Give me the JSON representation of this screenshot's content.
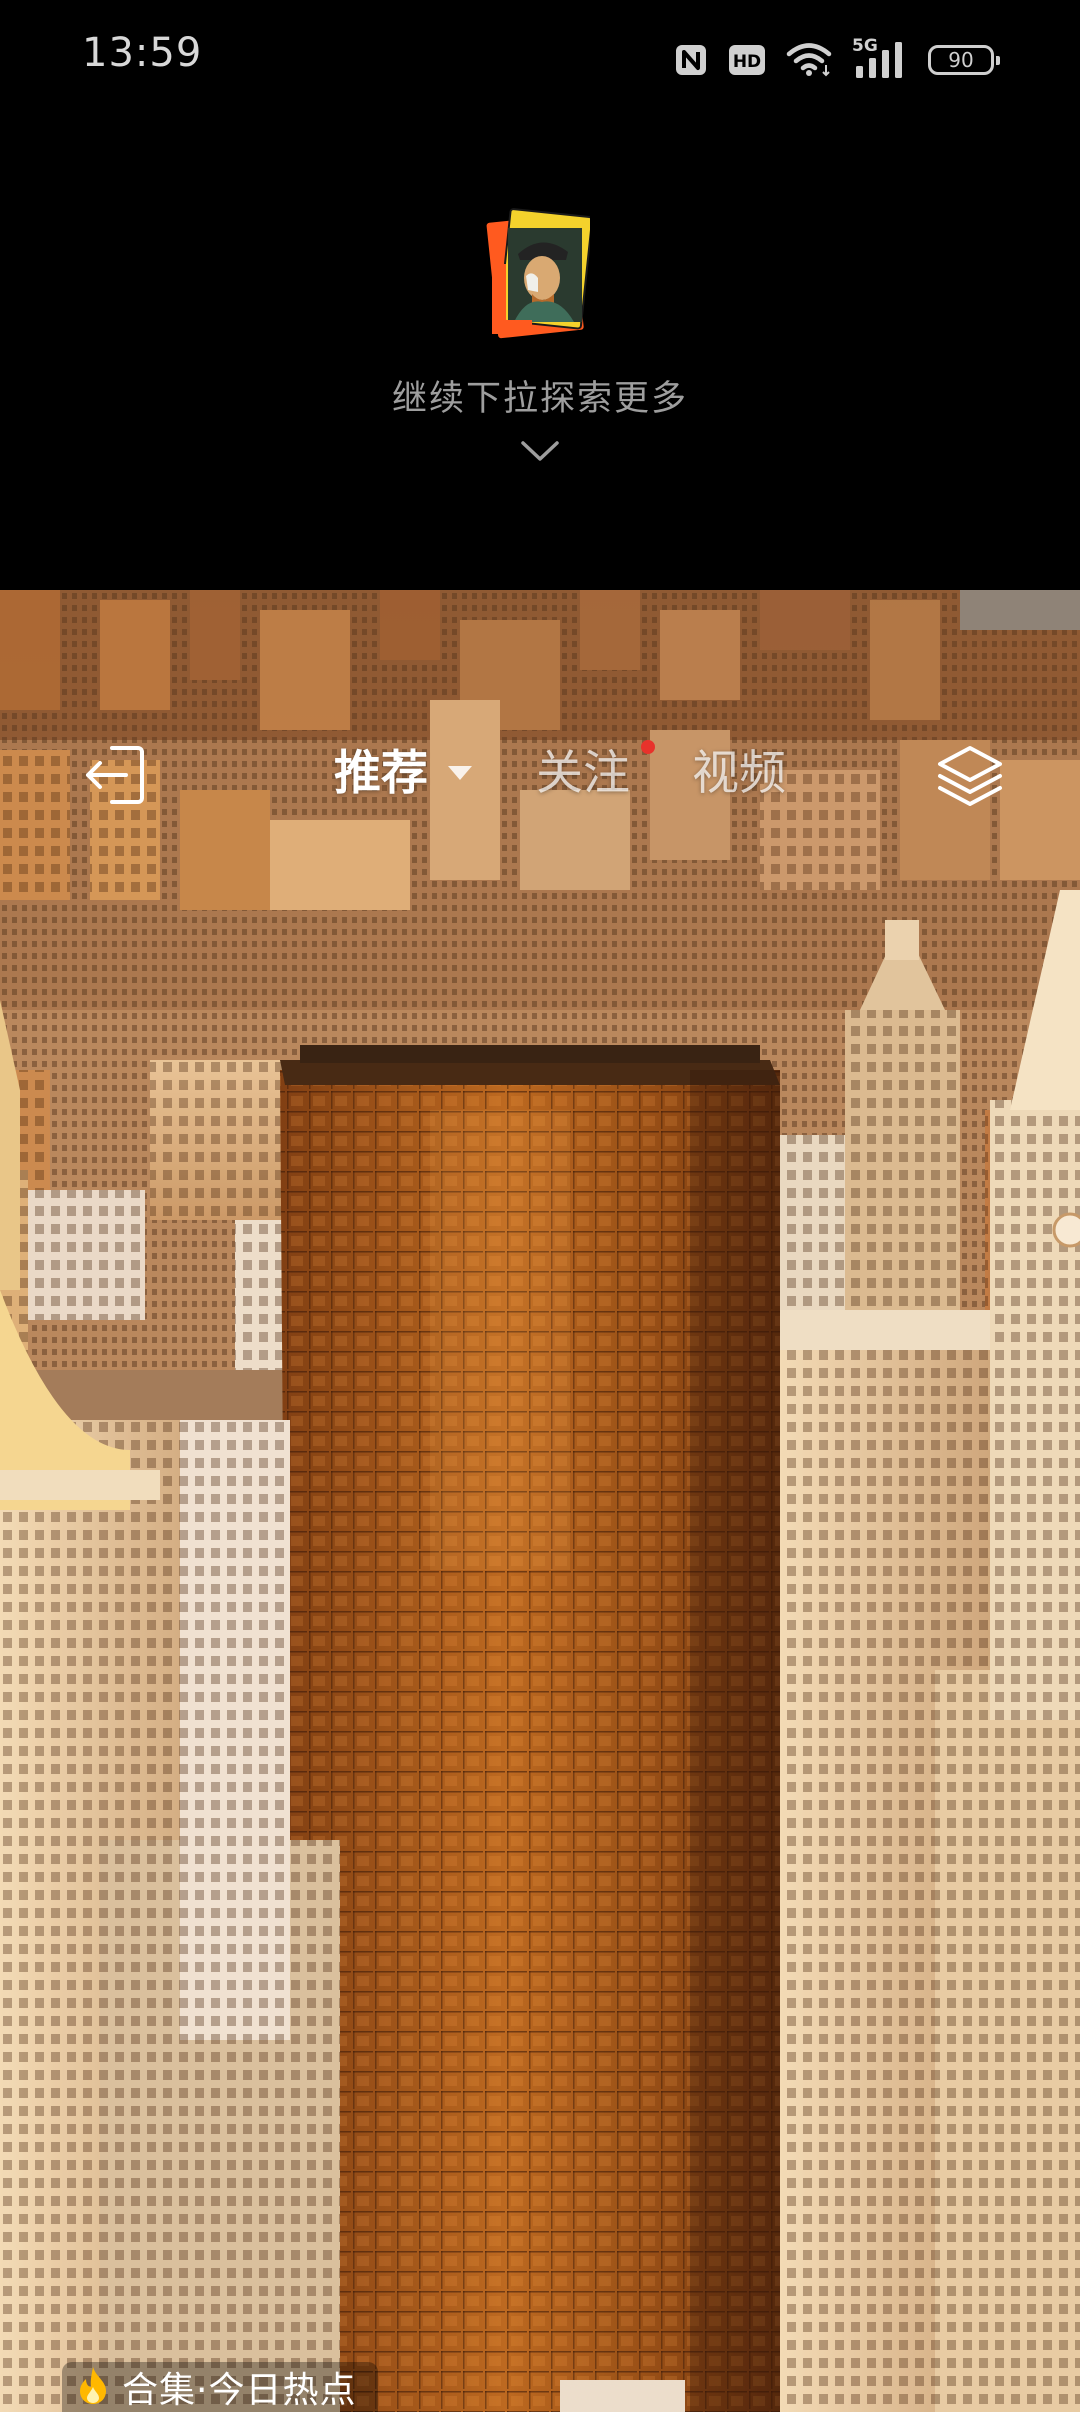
{
  "status_bar": {
    "time": "13:59",
    "nfc_icon": "nfc-icon",
    "hd_badge": "HD",
    "wifi_icon": "wifi-icon",
    "network_badge": "5G",
    "signal_icon": "signal-bars-icon",
    "battery_level": "90"
  },
  "explore": {
    "thumbnail_icon": "van-gogh-portrait-thumbnail",
    "hint_text": "继续下拉探索更多",
    "chevron_icon": "chevron-down-icon"
  },
  "top_nav": {
    "exit_icon": "exit-icon",
    "tabs": [
      {
        "label": "推荐",
        "active": true
      },
      {
        "label": "关注",
        "active": false,
        "has_notification_dot": true
      },
      {
        "label": "视频",
        "active": false
      }
    ],
    "notification_dot_color": "#e8322b",
    "layers_icon": "layers-icon"
  },
  "content": {
    "image_description_icon": "city-skyline-photo"
  },
  "collection": {
    "flame_icon": "flame-icon",
    "label": "合集·今日热点",
    "flame_color": "#ffb800"
  }
}
